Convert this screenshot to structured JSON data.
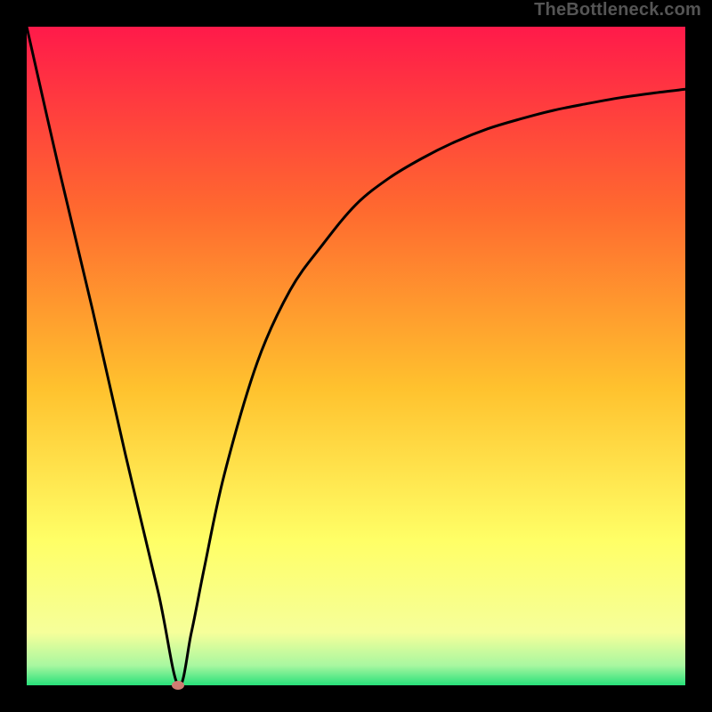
{
  "attribution": "TheBottleneck.com",
  "chart_data": {
    "type": "line",
    "title": "",
    "xlabel": "",
    "ylabel": "",
    "xlim": [
      0,
      100
    ],
    "ylim": [
      0,
      100
    ],
    "background_gradient": {
      "top": "#ff1a4a",
      "mid_upper": "#ff8a2a",
      "mid": "#ffd233",
      "mid_lower": "#ffff66",
      "bottom": "#28e07a"
    },
    "series": [
      {
        "name": "bottleneck-curve",
        "x": [
          0,
          5,
          10,
          15,
          20,
          23,
          25,
          27,
          30,
          35,
          40,
          45,
          50,
          55,
          60,
          65,
          70,
          75,
          80,
          85,
          90,
          95,
          100
        ],
        "y": [
          100,
          78,
          57,
          35,
          14,
          0,
          8,
          18,
          32,
          49,
          60,
          67,
          73,
          77,
          80,
          82.5,
          84.5,
          86,
          87.3,
          88.3,
          89.2,
          89.9,
          90.5
        ]
      }
    ],
    "marker": {
      "x": 23,
      "y": 0,
      "color": "#cf7c72"
    },
    "grid": false,
    "legend": false
  }
}
